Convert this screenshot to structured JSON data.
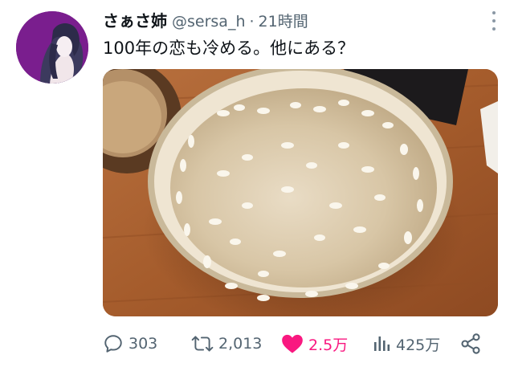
{
  "tweet": {
    "display_name": "さぁさ姉",
    "handle": "@sersa_h",
    "separator": "·",
    "time": "21時間",
    "text": "100年の恋も冷める。他にある？"
  },
  "actions": {
    "replies": "303",
    "retweets": "2,013",
    "likes": "2.5万",
    "views": "425万"
  },
  "colors": {
    "like": "#f91880",
    "secondary_text": "#536471",
    "avatar_bg": "#7a1e8e"
  },
  "icons": [
    "reply-icon",
    "retweet-icon",
    "heart-icon",
    "views-icon",
    "share-icon",
    "more-icon"
  ]
}
